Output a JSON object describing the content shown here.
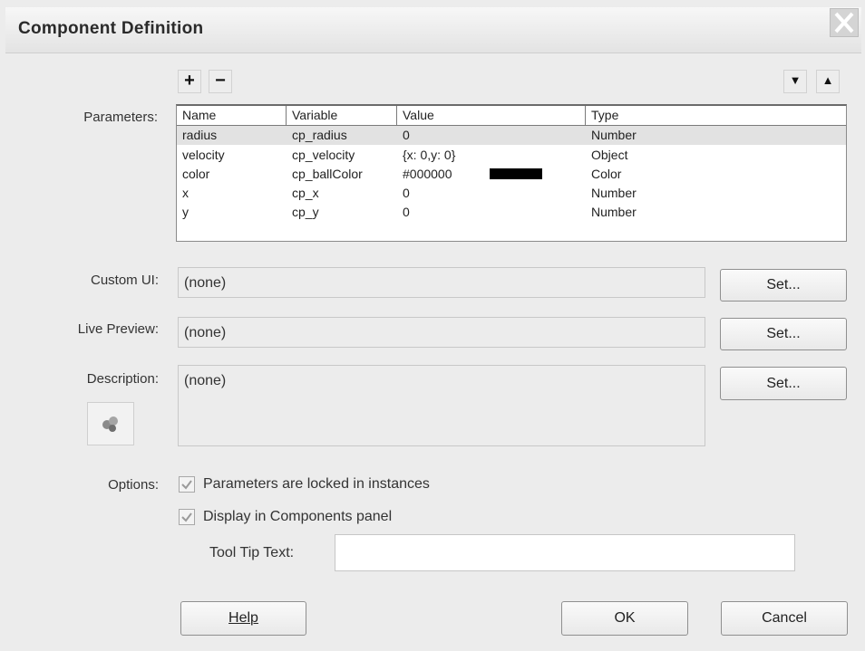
{
  "window": {
    "title": "Component Definition"
  },
  "parameters": {
    "label": "Parameters:",
    "add_label": "+",
    "remove_label": "−",
    "move_down_label": "▼",
    "move_up_label": "▲",
    "columns": [
      "Name",
      "Variable",
      "Value",
      "Type"
    ],
    "rows": [
      {
        "name": "radius",
        "variable": "cp_radius",
        "value": "0",
        "type": "Number",
        "selected": true
      },
      {
        "name": "velocity",
        "variable": "cp_velocity",
        "value": "{x: 0,y: 0}",
        "type": "Object"
      },
      {
        "name": "color",
        "variable": "cp_ballColor",
        "value": "#000000",
        "type": "Color",
        "swatch": "#000000"
      },
      {
        "name": "x",
        "variable": "cp_x",
        "value": "0",
        "type": "Number"
      },
      {
        "name": "y",
        "variable": "cp_y",
        "value": "0",
        "type": "Number"
      }
    ]
  },
  "custom_ui": {
    "label": "Custom UI:",
    "value": "(none)",
    "set_label": "Set..."
  },
  "live_preview": {
    "label": "Live Preview:",
    "value": "(none)",
    "set_label": "Set..."
  },
  "description": {
    "label": "Description:",
    "value": "(none)",
    "set_label": "Set..."
  },
  "options": {
    "label": "Options:",
    "locked_label": "Parameters are locked in instances",
    "locked_checked": true,
    "display_label": "Display in Components panel",
    "display_checked": true,
    "tooltip_label": "Tool Tip Text:",
    "tooltip_value": ""
  },
  "buttons": {
    "help": "Help",
    "ok": "OK",
    "cancel": "Cancel"
  },
  "colors": {
    "selected_row": "#e2e2e2",
    "dialog_bg": "#ececec"
  }
}
